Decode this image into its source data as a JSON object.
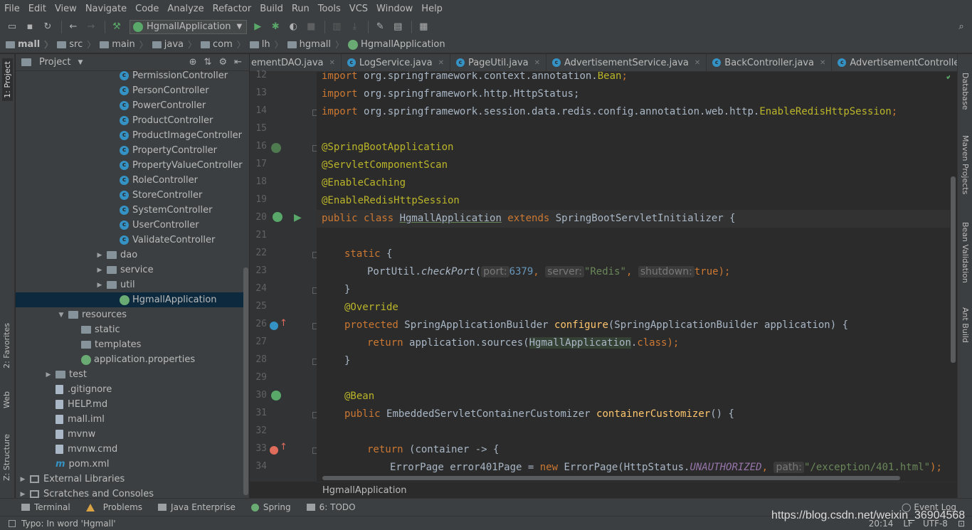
{
  "menu": [
    "File",
    "Edit",
    "View",
    "Navigate",
    "Code",
    "Analyze",
    "Refactor",
    "Build",
    "Run",
    "Tools",
    "VCS",
    "Window",
    "Help"
  ],
  "toolbar": {
    "run_config": "HgmallApplication",
    "icons": [
      "open-icon",
      "save-icon",
      "sync-icon",
      "back-icon",
      "forward-icon",
      "build-hammer-icon",
      "run-icon",
      "debug-icon",
      "coverage-icon",
      "stop-icon",
      "project-structure-icon",
      "sdk-icon",
      "wrench-icon",
      "structure-icon",
      "terminal-icon",
      "search-icon"
    ]
  },
  "breadcrumb": [
    "mall",
    "src",
    "main",
    "java",
    "com",
    "lh",
    "hgmall",
    "HgmallApplication"
  ],
  "left_strip": {
    "project": "1: Project",
    "favorites": "2: Favorites",
    "web": "Web",
    "structure": "Z: Structure"
  },
  "right_strip": {
    "database": "Database",
    "maven": "Maven Projects",
    "bean": "Bean Validation",
    "ant": "Ant Build"
  },
  "project_panel": {
    "title": "Project",
    "tree": [
      {
        "label": "PermissionController",
        "type": "class",
        "indent": 7
      },
      {
        "label": "PersonController",
        "type": "class",
        "indent": 7
      },
      {
        "label": "PowerController",
        "type": "class",
        "indent": 7
      },
      {
        "label": "ProductController",
        "type": "class",
        "indent": 7
      },
      {
        "label": "ProductImageController",
        "type": "class",
        "indent": 7
      },
      {
        "label": "PropertyController",
        "type": "class",
        "indent": 7
      },
      {
        "label": "PropertyValueController",
        "type": "class",
        "indent": 7
      },
      {
        "label": "RoleController",
        "type": "class",
        "indent": 7
      },
      {
        "label": "StoreController",
        "type": "class",
        "indent": 7
      },
      {
        "label": "SystemController",
        "type": "class",
        "indent": 7
      },
      {
        "label": "UserController",
        "type": "class",
        "indent": 7
      },
      {
        "label": "ValidateController",
        "type": "class",
        "indent": 7
      },
      {
        "label": "dao",
        "type": "folder",
        "indent": 6,
        "arrow": "▶"
      },
      {
        "label": "service",
        "type": "folder",
        "indent": 6,
        "arrow": "▶"
      },
      {
        "label": "util",
        "type": "folder",
        "indent": 6,
        "arrow": "▶"
      },
      {
        "label": "HgmallApplication",
        "type": "spring",
        "indent": 7,
        "selected": true
      },
      {
        "label": "resources",
        "type": "folder",
        "indent": 3,
        "arrow": "▼"
      },
      {
        "label": "static",
        "type": "folder",
        "indent": 4
      },
      {
        "label": "templates",
        "type": "folder",
        "indent": 4
      },
      {
        "label": "application.properties",
        "type": "spring",
        "indent": 4
      },
      {
        "label": "test",
        "type": "folder",
        "indent": 2,
        "arrow": "▶"
      },
      {
        "label": ".gitignore",
        "type": "file",
        "indent": 2
      },
      {
        "label": "HELP.md",
        "type": "file",
        "indent": 2
      },
      {
        "label": "mall.iml",
        "type": "file",
        "indent": 2
      },
      {
        "label": "mvnw",
        "type": "file",
        "indent": 2
      },
      {
        "label": "mvnw.cmd",
        "type": "file",
        "indent": 2
      },
      {
        "label": "pom.xml",
        "type": "maven",
        "indent": 2
      },
      {
        "label": "External Libraries",
        "type": "lib",
        "indent": 0,
        "arrow": "▶"
      },
      {
        "label": "Scratches and Consoles",
        "type": "lib",
        "indent": 0,
        "arrow": "▶"
      }
    ]
  },
  "tabs": [
    {
      "label": "ementDAO.java",
      "active": false
    },
    {
      "label": "LogService.java",
      "active": false
    },
    {
      "label": "PageUtil.java",
      "active": false
    },
    {
      "label": "AdvertisementService.java",
      "active": false
    },
    {
      "label": "BackController.java",
      "active": false
    },
    {
      "label": "AdvertisementController.java",
      "active": false
    }
  ],
  "line_numbers": [
    "12",
    "13",
    "14",
    "15",
    "16",
    "17",
    "18",
    "19",
    "20",
    "21",
    "22",
    "23",
    "24",
    "25",
    "26",
    "27",
    "28",
    "29",
    "30",
    "31",
    "32",
    "33",
    "34"
  ],
  "code": {
    "l12_import": "import ",
    "l12_pkg": "org.springframework.context.annotation.",
    "l12_cls": "Bean",
    "l12_end": ";",
    "l13_import": "import ",
    "l13_pkg": "org.springframework.http.HttpStatus;",
    "l14_import": "import ",
    "l14_pkg": "org.springframework.session.data.redis.config.annotation.web.http.",
    "l14_cls": "EnableRedisHttpSession",
    "l14_end": ";",
    "l16": "@SpringBootApplication",
    "l17": "@ServletComponentScan",
    "l18": "@EnableCaching",
    "l19": "@EnableRedisHttpSession",
    "l20_public": "public class ",
    "l20_name": "HgmallApplication",
    "l20_extends": " extends ",
    "l20_rest": "SpringBootServletInitializer {",
    "l22_static": "static ",
    "l22_brace": "{",
    "l23_call": "PortUtil.",
    "l23_method": "checkPort",
    "l23_open": "(",
    "l23_hint1": "port:",
    "l23_v1": "6379",
    "l23_c1": ", ",
    "l23_hint2": "server:",
    "l23_v2": "\"Redis\"",
    "l23_c2": ", ",
    "l23_hint3": "shutdown:",
    "l23_v3": "true",
    "l23_close": ");",
    "l24": "}",
    "l25": "@Override",
    "l26_prot": "protected ",
    "l26_type": "SpringApplicationBuilder ",
    "l26_method": "configure",
    "l26_rest": "(SpringApplicationBuilder application) {",
    "l27_return": "return ",
    "l27_call": "application.sources(",
    "l27_cls": "HgmallApplication",
    "l27_dot": ".",
    "l27_class": "class",
    "l27_end": ");",
    "l28": "}",
    "l30": "@Bean",
    "l31_public": "public ",
    "l31_type": "EmbeddedServletContainerCustomizer ",
    "l31_method": "containerCustomizer",
    "l31_rest": "() {",
    "l33_return": "return ",
    "l33_rest": "(container -> {",
    "l34_a": "ErrorPage error401Page = ",
    "l34_new": "new ",
    "l34_b": "ErrorPage(HttpStatus.",
    "l34_const": "UNAUTHORIZED",
    "l34_c": ", ",
    "l34_hint": "path:",
    "l34_str": "\"/exception/401.html\"",
    "l34_end": ");"
  },
  "editor_breadcrumb": "HgmallApplication",
  "bottom_tools": [
    "Terminal",
    "Problems",
    "Java Enterprise",
    "Spring",
    "6: TODO"
  ],
  "event_log": "Event Log",
  "status": {
    "message": "Typo: In word 'Hgmall'",
    "position": "20:14",
    "line_sep": "LF",
    "encoding": "UTF-8"
  },
  "watermark": "https://blog.csdn.net/weixin_36904568",
  "colors": {
    "keyword": "#cc7832",
    "annotation": "#bbb529",
    "number": "#6897bb",
    "string": "#6a8759",
    "method": "#ffc66d",
    "constant": "#9876aa",
    "selection": "#0d293e"
  }
}
